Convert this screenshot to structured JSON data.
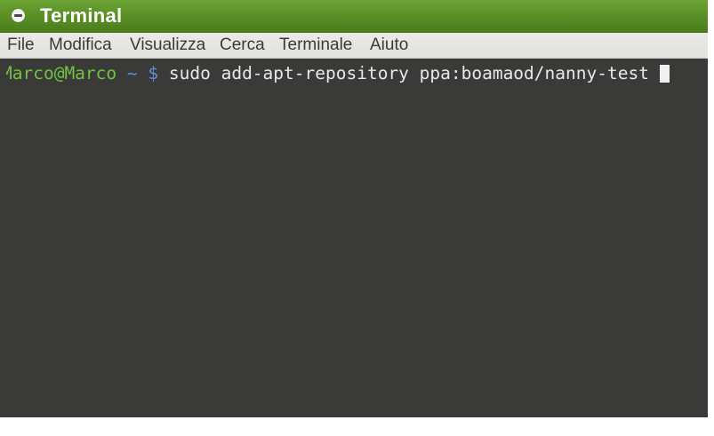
{
  "window": {
    "title": "Terminal",
    "button_icon": "window-menu-icon"
  },
  "menu": {
    "items": [
      "File",
      "Modifica",
      "Visualizza",
      "Cerca",
      "Terminale",
      "Aiuto"
    ]
  },
  "terminal": {
    "prompt_user": "Marco@Marco",
    "prompt_path": "~",
    "prompt_symbol": "$",
    "command": "sudo add-apt-repository ppa:boamaod/nanny-test"
  },
  "colors": {
    "titlebar_accent": "#5a8f26",
    "terminal_background": "#3a3a38",
    "prompt_user": "#72c23f",
    "prompt_path": "#5b8fd6",
    "terminal_text": "#e8e8e8",
    "menubar_background": "#e2e1de"
  }
}
